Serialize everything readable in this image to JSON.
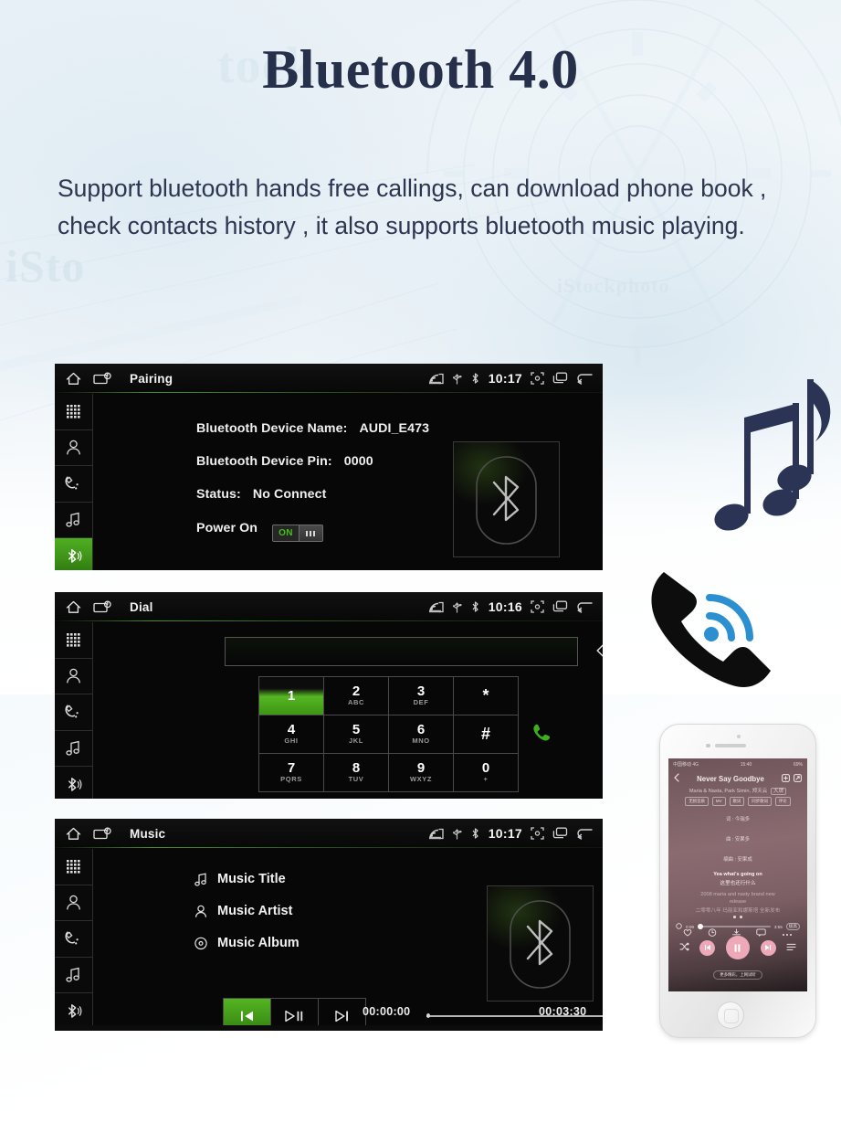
{
  "page": {
    "title": "Bluetooth 4.0",
    "description": "Support bluetooth hands free callings, can download phone book , check contacts history , it also supports bluetooth music playing.",
    "background_watermarks": [
      "iStock",
      "iStock",
      "iStock"
    ],
    "colors": {
      "title": "#26304a",
      "body_text": "#2d3550",
      "accent_green": "#4fae22",
      "screen_background": "#070707",
      "phone_icon_blue": "#2b8fd0",
      "music_note_navy": "#2c3455"
    }
  },
  "sidebar_icons": [
    {
      "name": "keypad-icon",
      "label": "Keypad"
    },
    {
      "name": "contacts-icon",
      "label": "Contacts"
    },
    {
      "name": "call-history-icon",
      "label": "Call History"
    },
    {
      "name": "music-icon",
      "label": "Music"
    },
    {
      "name": "bluetooth-icon",
      "label": "Bluetooth"
    }
  ],
  "screens": {
    "pairing": {
      "title": "Pairing",
      "time": "10:17",
      "active_sidebar": "bluetooth-icon",
      "rows": [
        {
          "label": "Bluetooth Device Name:",
          "value": "AUDI_E473"
        },
        {
          "label": "Bluetooth Device Pin:",
          "value": "0000"
        },
        {
          "label": "Status:",
          "value": "No Connect"
        }
      ],
      "power": {
        "label": "Power On",
        "toggle_state": "ON"
      }
    },
    "dial": {
      "title": "Dial",
      "time": "10:16",
      "active_sidebar": "keypad-icon",
      "input_value": "",
      "input_placeholder": "",
      "active_key": "1",
      "keys": [
        {
          "num": "1",
          "sub": ""
        },
        {
          "num": "2",
          "sub": "ABC"
        },
        {
          "num": "3",
          "sub": "DEF"
        },
        {
          "num": "*",
          "sub": ""
        },
        {
          "num": "4",
          "sub": "GHI"
        },
        {
          "num": "5",
          "sub": "JKL"
        },
        {
          "num": "6",
          "sub": "MNO"
        },
        {
          "num": "#",
          "sub": ""
        },
        {
          "num": "7",
          "sub": "PQRS"
        },
        {
          "num": "8",
          "sub": "TUV"
        },
        {
          "num": "9",
          "sub": "WXYZ"
        },
        {
          "num": "0",
          "sub": "+"
        }
      ]
    },
    "music": {
      "title": "Music",
      "time": "10:17",
      "active_sidebar": "bluetooth-icon",
      "info": [
        {
          "icon": "music-note-icon",
          "label": "Music Title"
        },
        {
          "icon": "artist-person-icon",
          "label": "Music Artist"
        },
        {
          "icon": "album-disc-icon",
          "label": "Music Album"
        }
      ],
      "controls": [
        {
          "name": "previous-track-button",
          "active": true
        },
        {
          "name": "play-pause-button",
          "active": false
        },
        {
          "name": "next-track-button",
          "active": false
        }
      ],
      "elapsed_time": "00:00:00",
      "total_time": "00:03:30"
    }
  },
  "status_bar_icons": [
    "cast-icon",
    "usb-icon",
    "bluetooth-icon",
    "fullscreen-icon",
    "recent-apps-icon",
    "back-arrow-icon"
  ],
  "decorations": {
    "music_notes": "music-notes-graphic",
    "phone_call": "phone-call-waves-graphic"
  },
  "iphone": {
    "status": {
      "left": "中国移动 4G",
      "center": "15:40",
      "right": "69%"
    },
    "track_title": "Never Say Goodbye",
    "artist": "Maria & Nasta,  Park Simin,  郑天云",
    "artist_badge": "大牌",
    "tags": [
      "无损音质",
      "MV",
      "歌词",
      "同步歌词",
      "评论"
    ],
    "credits": [
      "词 : 今瑞多",
      "曲 : 安果多",
      "编曲 : 安果成"
    ],
    "lyrics": [
      "Yea what's going on",
      "这里也还行什么",
      "2008 maria and nasty brand new",
      "release",
      "二零零八年  玛丽亚和娜斯塔  全新发布"
    ],
    "elapsed": "0:09",
    "remaining": "3:55",
    "quality_badge": "极高",
    "bottom_pill": "更多精彩，上网试听",
    "action_icons": [
      "heart-icon",
      "timer-icon",
      "download-icon",
      "comment-icon",
      "more-icon"
    ],
    "transport_icons": [
      "shuffle-icon",
      "previous-icon",
      "pause-icon",
      "next-icon",
      "playlist-icon"
    ]
  }
}
